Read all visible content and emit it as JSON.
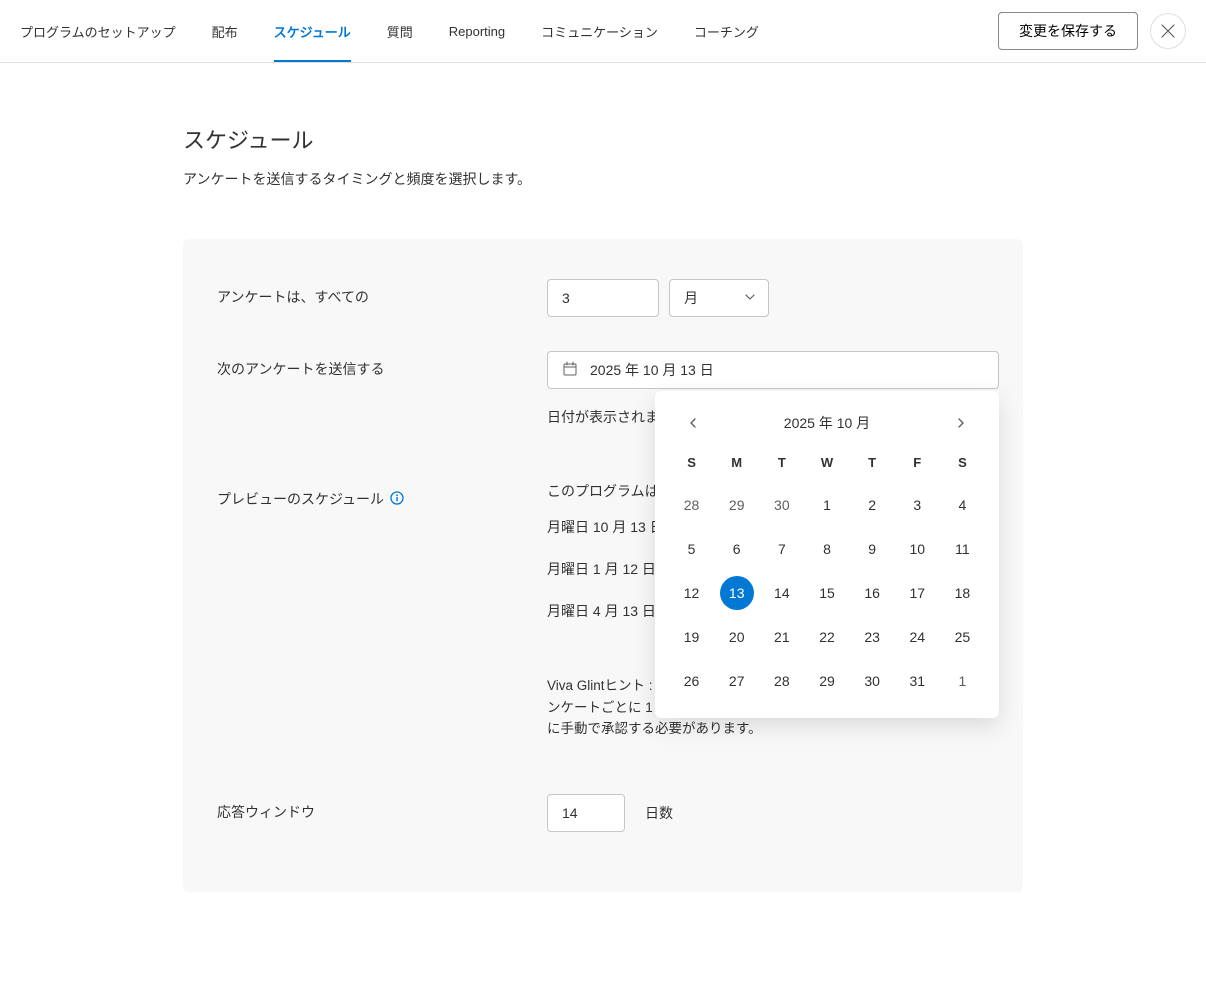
{
  "topbar": {
    "tabs": [
      {
        "label": "プログラムのセットアップ"
      },
      {
        "label": "配布"
      },
      {
        "label": "スケジュール",
        "active": true
      },
      {
        "label": "質問"
      },
      {
        "label": "Reporting"
      },
      {
        "label": "コミュニケーション"
      },
      {
        "label": "コーチング"
      }
    ],
    "save_label": "変更を保存する"
  },
  "page": {
    "title": "スケジュール",
    "desc": "アンケートを送信するタイミングと頻度を選択します。"
  },
  "frequency": {
    "label": "アンケートは、すべての",
    "count": "3",
    "unit": "月"
  },
  "next_send": {
    "label": "次のアンケートを送信する",
    "value": "2025 年 10 月 13 日",
    "help": "日付が表示されます"
  },
  "preview": {
    "label": "プレビューのスケジュール",
    "intro": "このプログラムは、2025.1t が繰り返されます",
    "items": [
      "月曜日 10 月 13 日、2 日",
      "月曜日 1 月 12 日、21 日",
      "月曜日 4 月 13 日、2 日"
    ],
    "hint": "Viva Glintヒント : IS Just a previewを超える場合、アンケートの評価はアンケートごとに 1 つずつ引き上げられます。アンケートは送信される前に手動で承認する必要があります。"
  },
  "response_window": {
    "label": "応答ウィンドウ",
    "value": "14",
    "suffix": "日数"
  },
  "calendar": {
    "month_label": "2025 年 10 月",
    "dows": [
      "S",
      "M",
      "T",
      "W",
      "T",
      "F",
      "S"
    ],
    "weeks": [
      [
        {
          "n": "28"
        },
        {
          "n": "29"
        },
        {
          "n": "30"
        },
        {
          "n": "1",
          "in": true
        },
        {
          "n": "2",
          "in": true
        },
        {
          "n": "3",
          "in": true
        },
        {
          "n": "4",
          "in": true
        }
      ],
      [
        {
          "n": "5",
          "in": true
        },
        {
          "n": "6",
          "in": true
        },
        {
          "n": "7",
          "in": true
        },
        {
          "n": "8",
          "in": true
        },
        {
          "n": "9",
          "in": true
        },
        {
          "n": "10",
          "in": true
        },
        {
          "n": "11",
          "in": true
        }
      ],
      [
        {
          "n": "12",
          "in": true
        },
        {
          "n": "13",
          "in": true,
          "sel": true
        },
        {
          "n": "14",
          "in": true
        },
        {
          "n": "15",
          "in": true
        },
        {
          "n": "16",
          "in": true
        },
        {
          "n": "17",
          "in": true
        },
        {
          "n": "18",
          "in": true
        }
      ],
      [
        {
          "n": "19",
          "in": true
        },
        {
          "n": "20",
          "in": true
        },
        {
          "n": "21",
          "in": true
        },
        {
          "n": "22",
          "in": true
        },
        {
          "n": "23",
          "in": true
        },
        {
          "n": "24",
          "in": true
        },
        {
          "n": "25",
          "in": true
        }
      ],
      [
        {
          "n": "26",
          "in": true
        },
        {
          "n": "27",
          "in": true
        },
        {
          "n": "28",
          "in": true
        },
        {
          "n": "29",
          "in": true
        },
        {
          "n": "30",
          "in": true
        },
        {
          "n": "31",
          "in": true
        },
        {
          "n": "1"
        }
      ]
    ]
  }
}
